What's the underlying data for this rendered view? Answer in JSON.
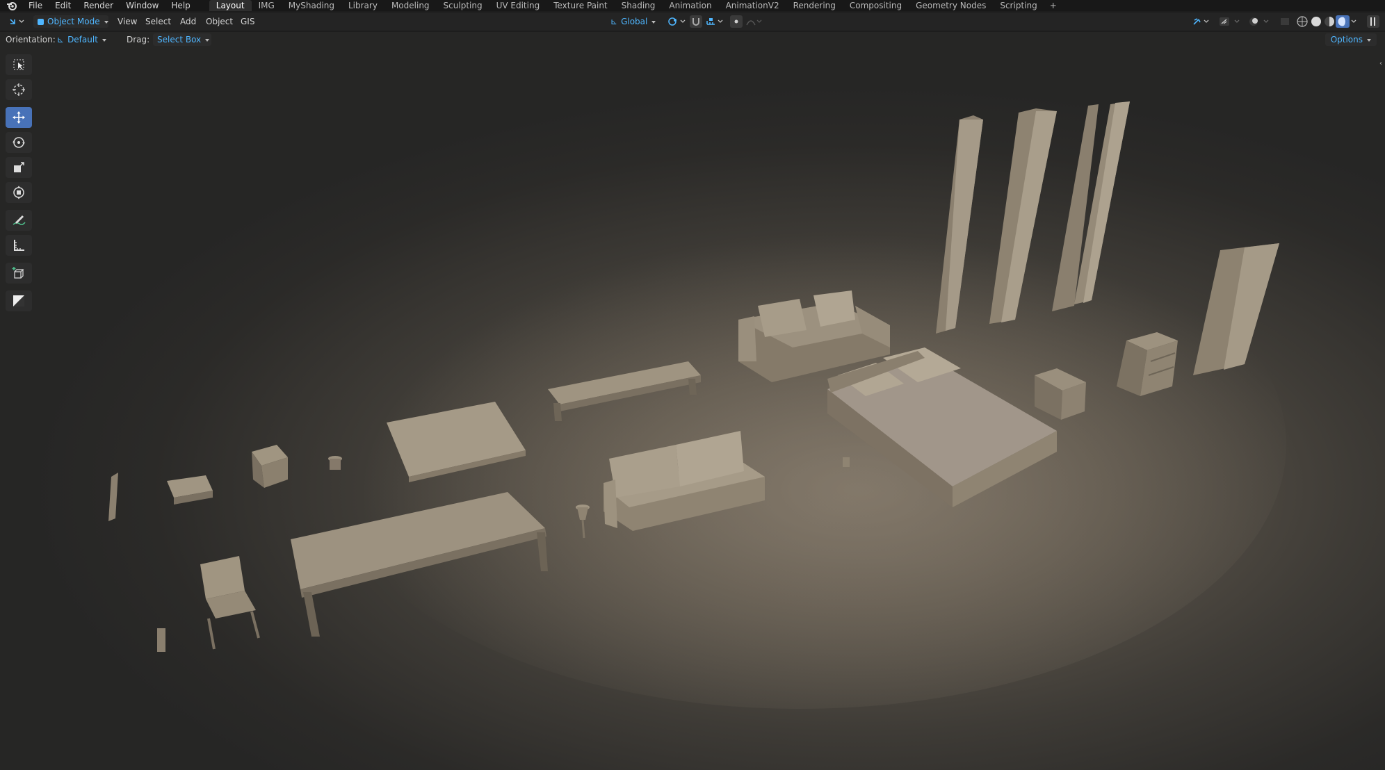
{
  "menubar": {
    "menus": [
      "File",
      "Edit",
      "Render",
      "Window",
      "Help"
    ],
    "workspaces": [
      "Layout",
      "IMG",
      "MyShading",
      "Library",
      "Modeling",
      "Sculpting",
      "UV Editing",
      "Texture Paint",
      "Shading",
      "Animation",
      "AnimationV2",
      "Rendering",
      "Compositing",
      "Geometry Nodes",
      "Scripting"
    ],
    "active_workspace": "Layout",
    "add_tab": "+"
  },
  "header": {
    "mode": "Object Mode",
    "menus": [
      "View",
      "Select",
      "Add",
      "Object",
      "GIS"
    ],
    "transform_orientation": "Global"
  },
  "tool_settings": {
    "orientation_label": "Orientation:",
    "orientation_value": "Default",
    "drag_label": "Drag:",
    "drag_value": "Select Box",
    "options": "Options"
  },
  "toolbar": {
    "tools": [
      "select-box-icon",
      "cursor-icon",
      "move-icon",
      "rotate-icon",
      "scale-icon",
      "transform-icon",
      "annotate-icon",
      "measure-icon",
      "add-cube-icon",
      "image-icon"
    ],
    "active_tool": "move-icon"
  },
  "colors": {
    "accent": "#4fb6ff",
    "active_tool": "#4872b8",
    "menubar": "#181818",
    "header": "#242424"
  }
}
